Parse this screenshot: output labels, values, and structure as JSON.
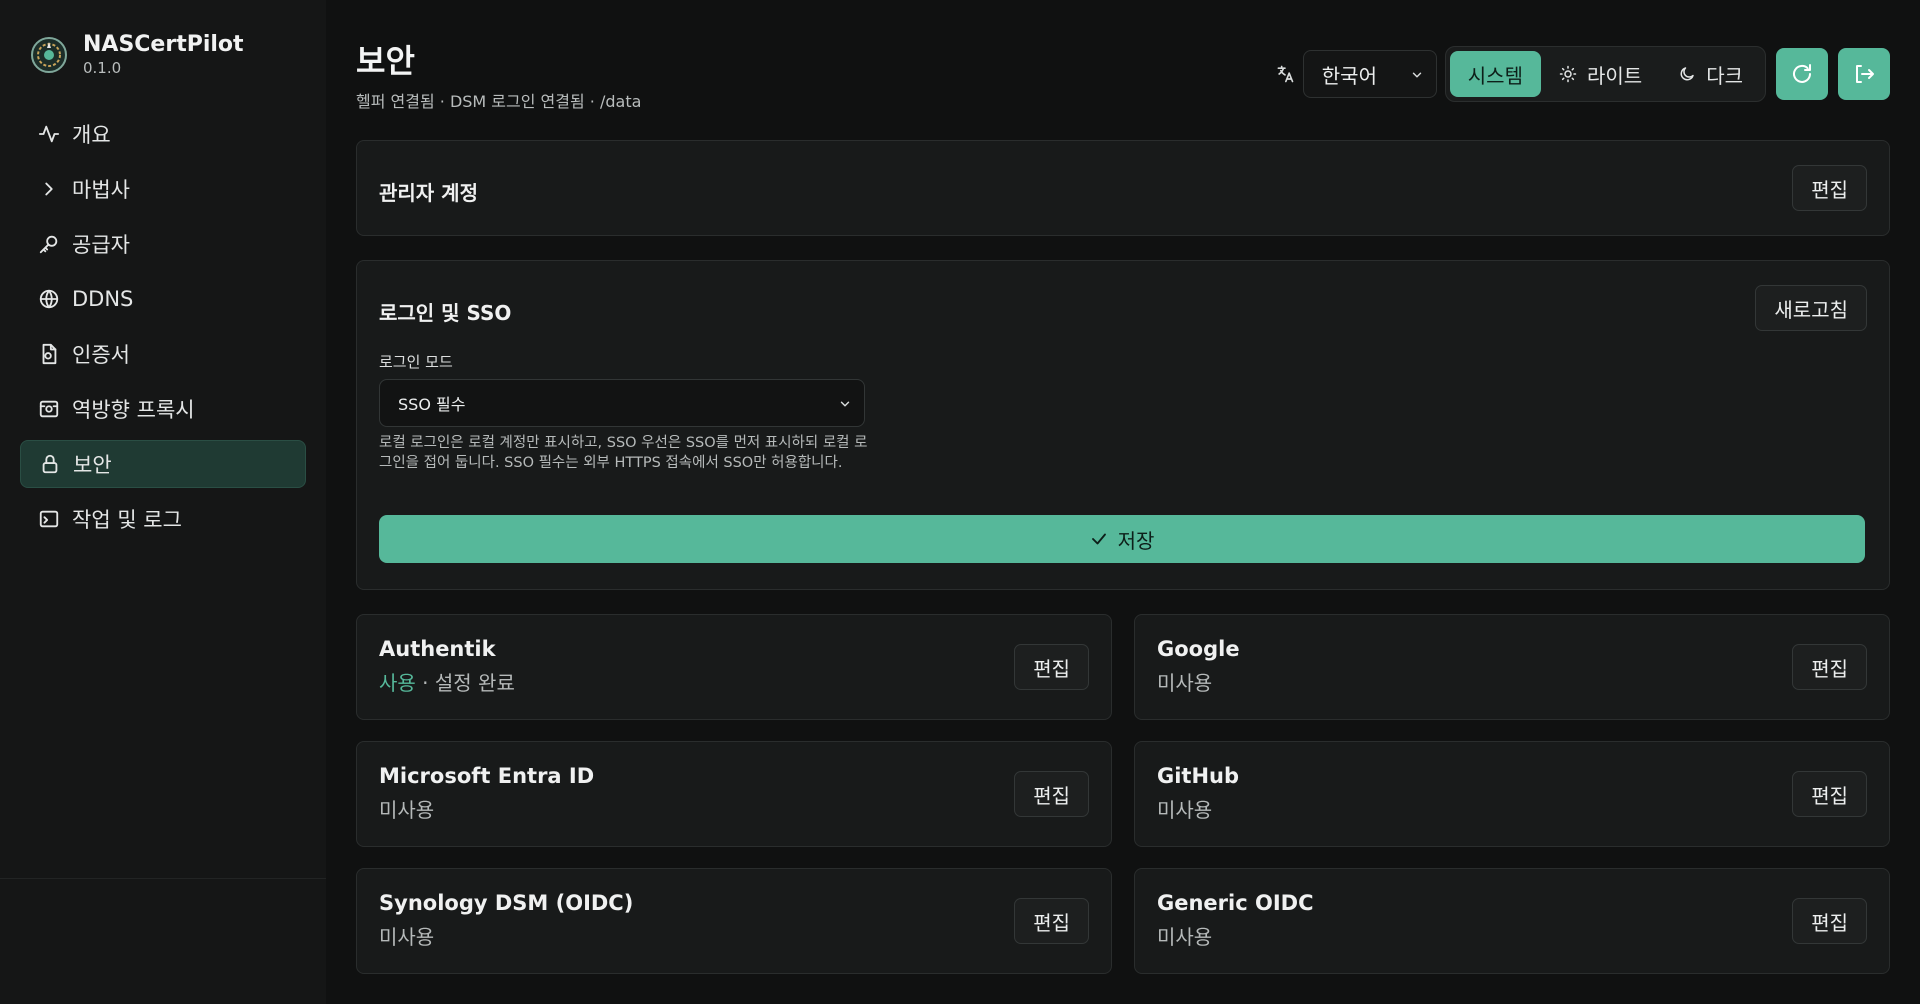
{
  "app": {
    "name": "NASCertPilot",
    "version": "0.1.0"
  },
  "sidebar": {
    "items": [
      {
        "label": "개요",
        "icon": "activity-icon"
      },
      {
        "label": "마법사",
        "icon": "chevron-right-icon"
      },
      {
        "label": "공급자",
        "icon": "key-icon"
      },
      {
        "label": "DDNS",
        "icon": "globe-icon"
      },
      {
        "label": "인증서",
        "icon": "file-cert-icon"
      },
      {
        "label": "역방향 프록시",
        "icon": "proxy-icon"
      },
      {
        "label": "보안",
        "icon": "lock-icon",
        "active": true
      },
      {
        "label": "작업 및 로그",
        "icon": "terminal-icon"
      }
    ]
  },
  "header": {
    "title": "보안",
    "subtitle": "헬퍼 연결됨 · DSM 로그인 연결됨 · /data",
    "language": "한국어",
    "theme": {
      "system": "시스템",
      "light": "라이트",
      "dark": "다크",
      "active": "system"
    }
  },
  "admin_card": {
    "title": "관리자 계정",
    "edit_label": "편집"
  },
  "login_card": {
    "title": "로그인 및 SSO",
    "refresh_label": "새로고침",
    "mode_label": "로그인 모드",
    "mode_value": "SSO 필수",
    "help_text": "로컬 로그인은 로컬 계정만 표시하고, SSO 우선은 SSO를 먼저 표시하되 로컬 로그인을 접어 둡니다. SSO 필수는 외부 HTTPS 접속에서 SSO만 허용합니다.",
    "save_label": "저장"
  },
  "providers": [
    {
      "name": "Authentik",
      "status_on": "사용",
      "status_rest": " · 설정 완료",
      "edit_label": "편집"
    },
    {
      "name": "Google",
      "status_on": "",
      "status_rest": "미사용",
      "edit_label": "편집"
    },
    {
      "name": "Microsoft Entra ID",
      "status_on": "",
      "status_rest": "미사용",
      "edit_label": "편집"
    },
    {
      "name": "GitHub",
      "status_on": "",
      "status_rest": "미사용",
      "edit_label": "편집"
    },
    {
      "name": "Synology DSM (OIDC)",
      "status_on": "",
      "status_rest": "미사용",
      "edit_label": "편집"
    },
    {
      "name": "Generic OIDC",
      "status_on": "",
      "status_rest": "미사용",
      "edit_label": "편집"
    }
  ],
  "colors": {
    "accent": "#56b89a",
    "background": "#101111",
    "card": "#181a1a"
  }
}
